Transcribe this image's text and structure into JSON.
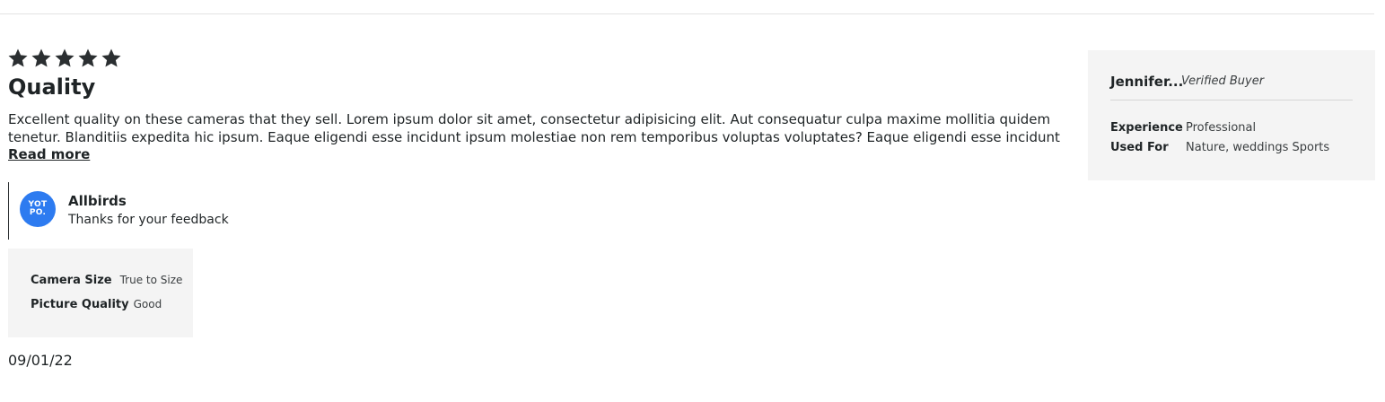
{
  "review": {
    "rating": 5,
    "title": "Quality",
    "body": "Excellent quality on these cameras that they sell. Lorem ipsum dolor sit amet, consectetur adipisicing elit. Aut consequatur culpa maxime mollitia quidem tenetur. Blanditiis expedita hic ipsum. Eaque eligendi esse incidunt ipsum molestiae non rem temporibus voluptas voluptates?  Eaque eligendi esse incidunt",
    "read_more": "Read more",
    "date": "09/01/22"
  },
  "reply": {
    "logo_line1": "YOT",
    "logo_line2": "PO.",
    "name": "Allbirds",
    "text": "Thanks for your feedback"
  },
  "attributes": [
    {
      "label": "Camera Size",
      "value": "True to Size"
    },
    {
      "label": "Picture Quality",
      "value": "Good"
    }
  ],
  "reviewer": {
    "name": "Jennifer...",
    "badge": "Verified Buyer",
    "details": [
      {
        "label": "Experience",
        "value": "Professional"
      },
      {
        "label": "Used For",
        "value": "Nature, weddings Sports"
      }
    ]
  },
  "colors": {
    "text": "#1f2426",
    "star": "#2b2f31",
    "panel_bg": "#f4f4f4",
    "yotpo_blue": "#2d7bf0"
  },
  "icons": {
    "star": "star-icon",
    "logo": "yotpo-logo"
  }
}
